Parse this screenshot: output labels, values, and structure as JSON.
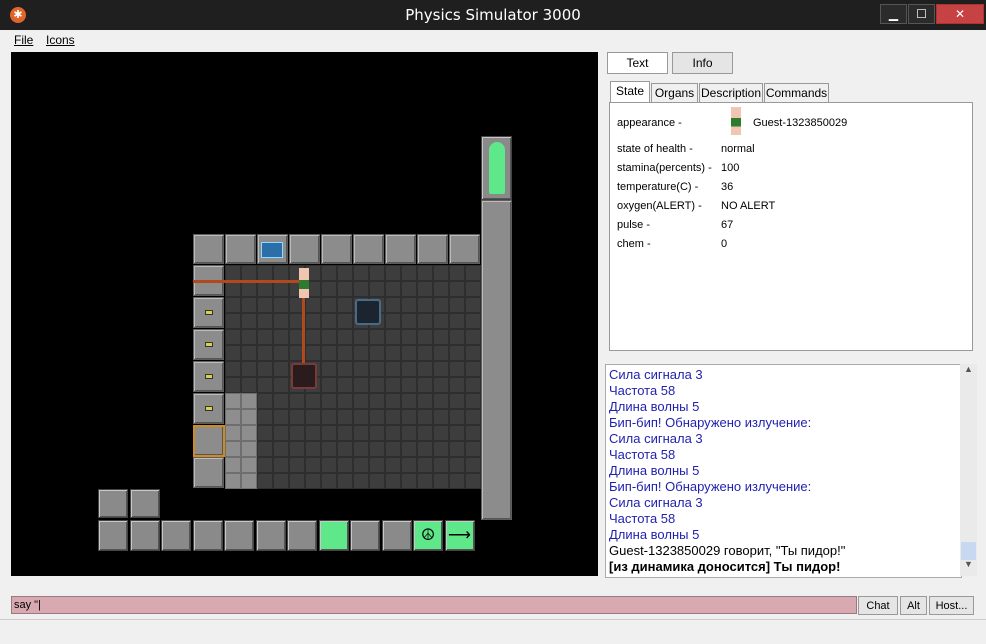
{
  "window": {
    "title": "Physics Simulator 3000",
    "minimize": "▁",
    "maximize": "☐",
    "close": "✕"
  },
  "menu": {
    "file": "File",
    "icons": "Icons"
  },
  "top_buttons": {
    "text": "Text",
    "info": "Info"
  },
  "tabs": [
    "State",
    "Organs",
    "Description",
    "Commands"
  ],
  "state": {
    "appearance_label": "appearance -",
    "appearance_name": "Guest-1323850029",
    "rows": [
      {
        "label": "state of health -",
        "value": "normal"
      },
      {
        "label": "stamina(percents) -",
        "value": "100"
      },
      {
        "label": "temperature(C) -",
        "value": "36"
      },
      {
        "label": "oxygen(ALERT) -",
        "value": "NO ALERT"
      },
      {
        "label": "pulse -",
        "value": "67"
      },
      {
        "label": "chem -",
        "value": "0"
      }
    ]
  },
  "output_lines": [
    {
      "text": "Сила сигнала 3",
      "style": "blue"
    },
    {
      "text": "Частота 58",
      "style": "blue"
    },
    {
      "text": "Длина волны 5",
      "style": "blue"
    },
    {
      "text": "Бип-бип! Обнаружено излучение:",
      "style": "blue"
    },
    {
      "text": "Сила сигнала 3",
      "style": "blue"
    },
    {
      "text": "Частота 58",
      "style": "blue"
    },
    {
      "text": "Длина волны 5",
      "style": "blue"
    },
    {
      "text": "Бип-бип! Обнаружено излучение:",
      "style": "blue"
    },
    {
      "text": "Сила сигнала 3",
      "style": "blue"
    },
    {
      "text": "Частота 58",
      "style": "blue"
    },
    {
      "text": "Длина волны 5",
      "style": "blue"
    },
    {
      "text": "Guest-1323850029 говорит, \"Ты пидор!\"",
      "style": "black"
    },
    {
      "text": "[из динамика доносится] Ты пидор!",
      "style": "bold"
    }
  ],
  "input": {
    "value": "say \"|"
  },
  "bottom_buttons": {
    "chat": "Chat",
    "alt": "Alt",
    "host": "Host..."
  },
  "colors": {
    "accent_green": "#5fe88a",
    "chat_blue": "#1f1fb0",
    "input_bg": "#d9a9b2"
  }
}
